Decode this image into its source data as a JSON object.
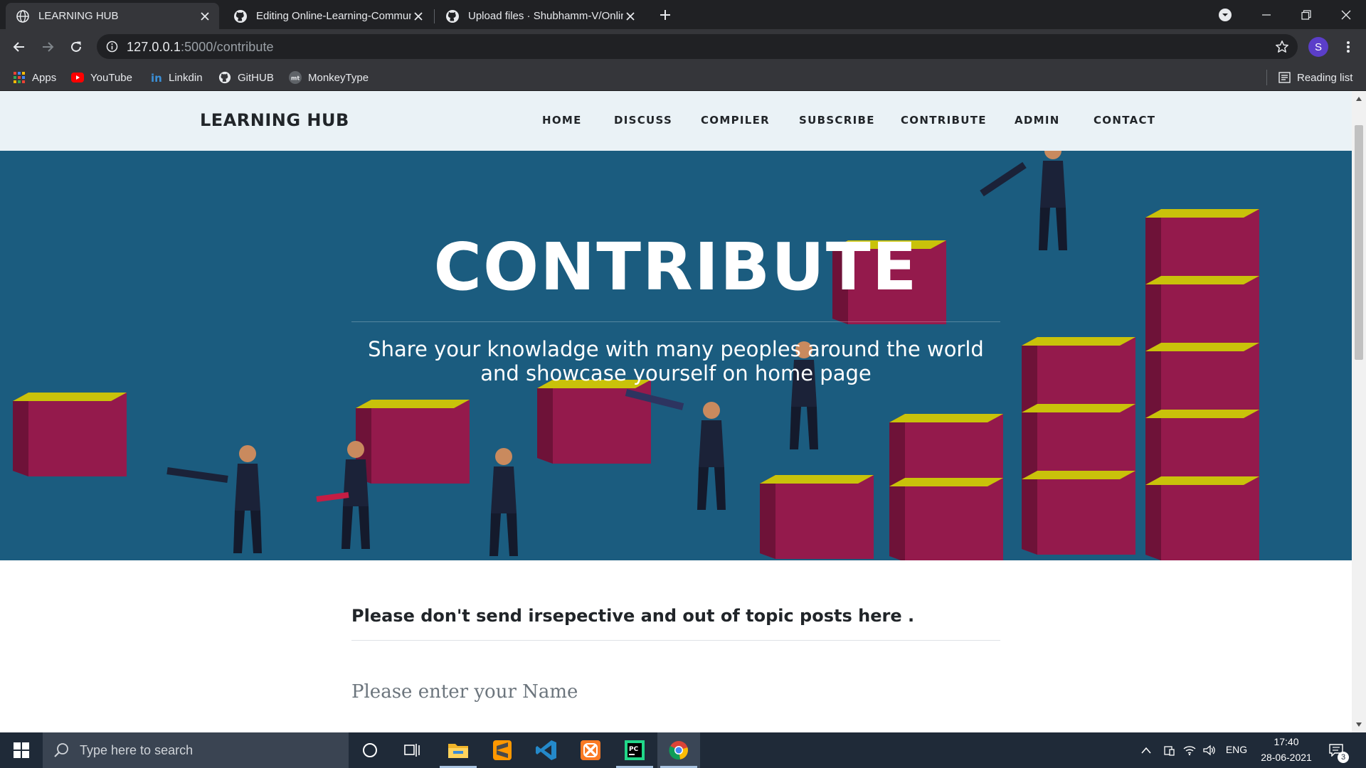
{
  "browser": {
    "tabs": [
      {
        "title": "LEARNING HUB",
        "active": true,
        "icon": "globe-icon"
      },
      {
        "title": "Editing Online-Learning-Commun",
        "active": false,
        "icon": "github-icon"
      },
      {
        "title": "Upload files · Shubhamm-V/Onlin",
        "active": false,
        "icon": "github-icon"
      }
    ],
    "url_host": "127.0.0.1",
    "url_path": ":5000/contribute",
    "profile_initial": "S",
    "bookmarks": [
      {
        "label": "Apps",
        "icon": "apps-grid-icon"
      },
      {
        "label": "YouTube",
        "icon": "youtube-icon"
      },
      {
        "label": "Linkdin",
        "icon": "linkedin-icon"
      },
      {
        "label": "GitHUB",
        "icon": "github-icon"
      },
      {
        "label": "MonkeyType",
        "icon": "monkeytype-icon"
      }
    ],
    "reading_list": "Reading list"
  },
  "site": {
    "brand": "LEARNING HUB",
    "nav": [
      "HOME",
      "DISCUSS",
      "COMPILER",
      "SUBSCRIBE",
      "CONTRIBUTE",
      "ADMIN",
      "CONTACT"
    ],
    "hero": {
      "title": "CONTRIBUTE",
      "subtitle": "Share your knowladge with many peoples around the world and showcase yourself on home page"
    },
    "notice": "Please don't send irsepective and out of topic posts here .",
    "name_placeholder": "Please enter your Name"
  },
  "taskbar": {
    "search_placeholder": "Type here to search",
    "apps": [
      "cortana-icon",
      "task-view-icon",
      "file-explorer-icon",
      "sublime-text-icon",
      "vscode-icon",
      "xampp-icon",
      "pycharm-icon",
      "chrome-icon"
    ],
    "language": "ENG",
    "time": "17:40",
    "date": "28-06-2021",
    "notification_count": "3"
  },
  "colors": {
    "hero_bg": "#1b5c7f",
    "box_color": "#941a4c",
    "box_top": "#c9c20a"
  }
}
